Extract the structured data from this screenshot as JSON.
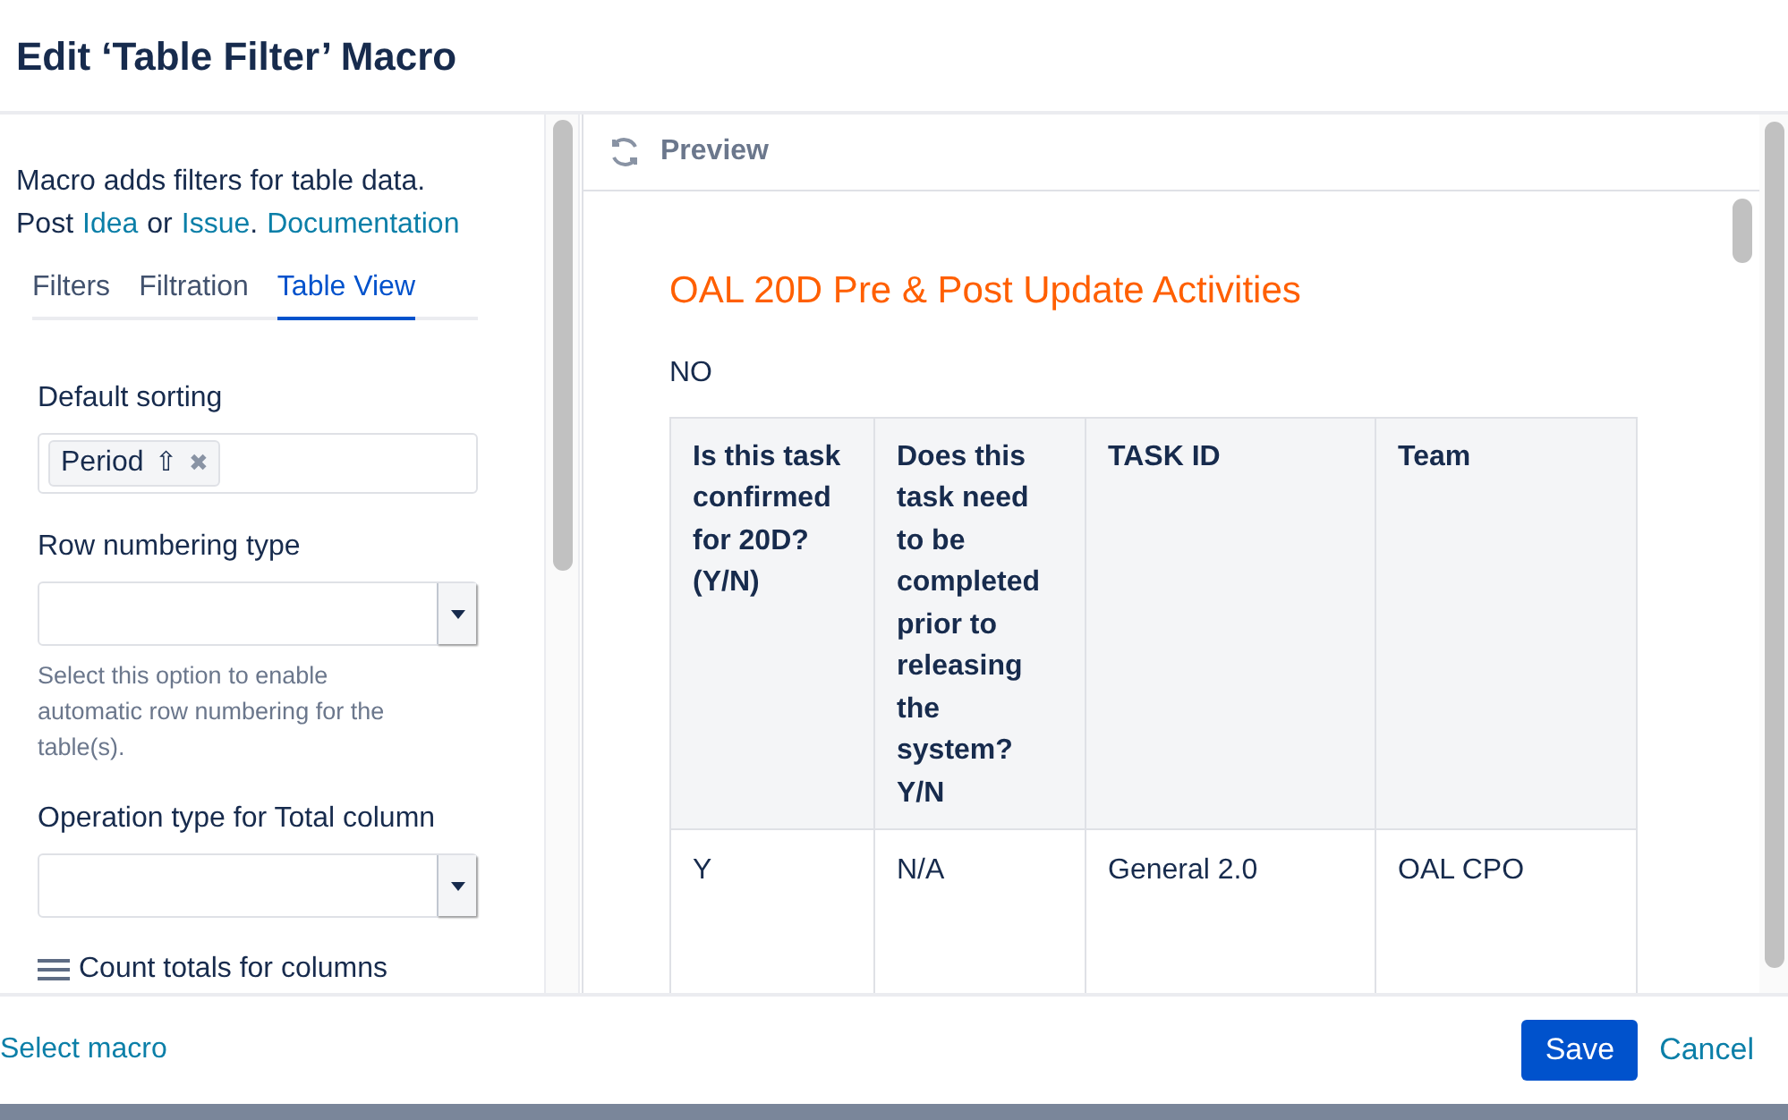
{
  "dialog": {
    "title": "Edit ‘Table Filter’ Macro"
  },
  "sidebar": {
    "intro": "Macro adds filters for table data.",
    "post_prefix": "Post",
    "links": [
      {
        "label": "Idea"
      },
      {
        "label": "Issue"
      },
      {
        "label": "Documentation"
      }
    ],
    "link_joiner": "or",
    "link_period": ".",
    "tabs": [
      {
        "label": "Filters",
        "selected": false
      },
      {
        "label": "Filtration",
        "selected": false
      },
      {
        "label": "Table View",
        "selected": true
      }
    ],
    "fields": [
      {
        "kind": "tags",
        "label": "Default sorting",
        "tags": [
          {
            "label": "Period",
            "arrow": "⇧",
            "remove": "✖"
          }
        ]
      },
      {
        "kind": "select",
        "label": "Row numbering type",
        "hint": "Select this option to enable automatic row numbering for the table(s)."
      },
      {
        "kind": "select",
        "label": "Operation type for Total column"
      }
    ],
    "count_totals": "Count totals for columns"
  },
  "preview": {
    "title": "Preview",
    "heading": "OAL 20D Pre & Post Update Activities",
    "note": "NO",
    "table": {
      "columns": [
        "Is this task confirmed for 20D? (Y/N)",
        "Does this task need to be completed prior to releasing the system? Y/N",
        "TASK ID",
        "Team"
      ],
      "rows": [
        [
          "Y",
          "N/A",
          "General 2.0",
          "OAL CPO"
        ]
      ]
    }
  },
  "footer": {
    "back": "Select macro",
    "save": "Save",
    "cancel": "Cancel"
  }
}
